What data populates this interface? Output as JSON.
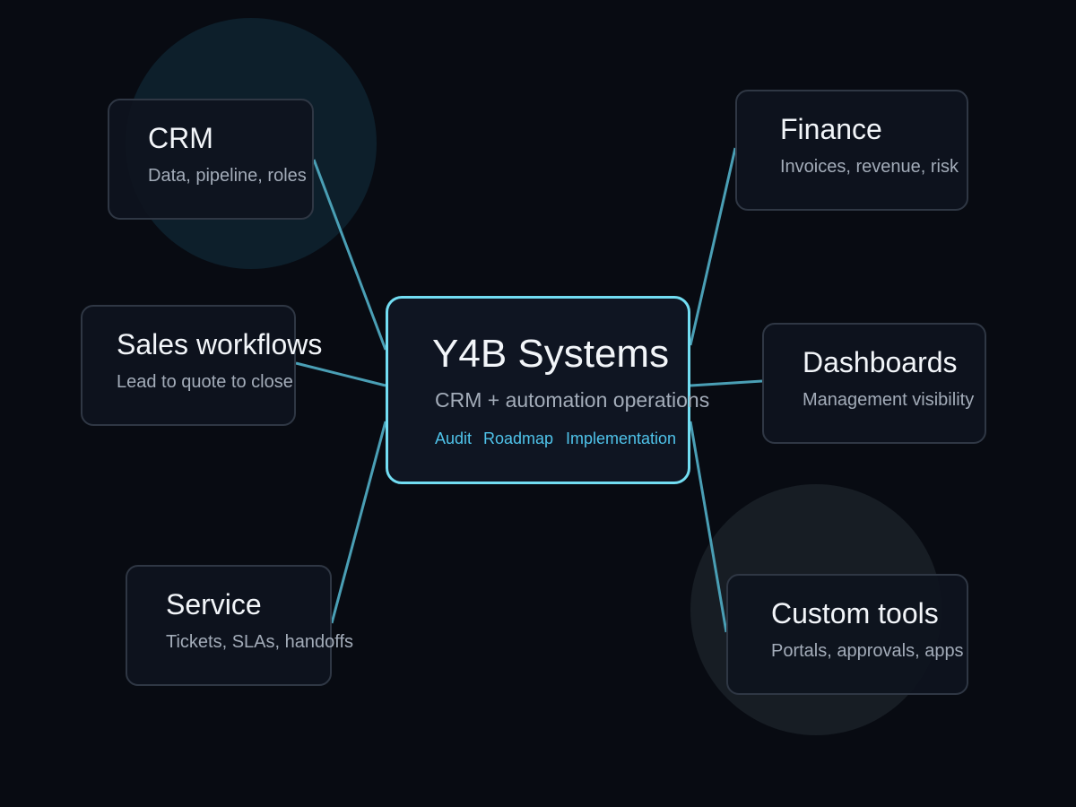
{
  "colors": {
    "background": "#080b12",
    "accent": "#72ddf2",
    "connector": "#4a9fb5",
    "tag": "#4fc3ea",
    "node_border": "#2f3744"
  },
  "hub": {
    "title": "Y4B Systems",
    "subtitle": "CRM + automation operations",
    "tags": [
      "Audit",
      "Roadmap",
      "Implementation"
    ]
  },
  "nodes": [
    {
      "id": "crm",
      "title": "CRM",
      "subtitle": "Data, pipeline, roles"
    },
    {
      "id": "sales-workflows",
      "title": "Sales workflows",
      "subtitle": "Lead to quote to close"
    },
    {
      "id": "service",
      "title": "Service",
      "subtitle": "Tickets, SLAs, handoffs"
    },
    {
      "id": "finance",
      "title": "Finance",
      "subtitle": "Invoices, revenue, risk"
    },
    {
      "id": "dashboards",
      "title": "Dashboards",
      "subtitle": "Management visibility"
    },
    {
      "id": "custom-tools",
      "title": "Custom tools",
      "subtitle": "Portals, approvals, apps"
    }
  ]
}
